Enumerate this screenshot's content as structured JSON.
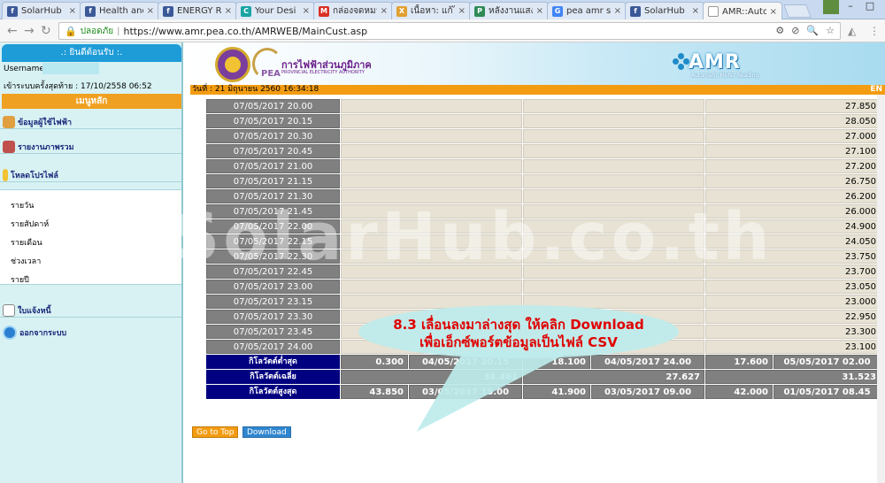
{
  "browser": {
    "tabs": [
      {
        "title": "SolarHub",
        "color": "#3b5998",
        "glyph": "f"
      },
      {
        "title": "Health and",
        "color": "#3b5998",
        "glyph": "f"
      },
      {
        "title": "ENERGY R",
        "color": "#3b5998",
        "glyph": "f"
      },
      {
        "title": "Your Desi",
        "color": "#1aa3a3",
        "glyph": "C"
      },
      {
        "title": "กล่องจดหมา",
        "color": "#d93025",
        "glyph": "M"
      },
      {
        "title": "เนื้อหา: แก้ไข",
        "color": "#e0a030",
        "glyph": "X"
      },
      {
        "title": "หลังงานแสง",
        "color": "#2e8b57",
        "glyph": "P"
      },
      {
        "title": "pea amr s",
        "color": "#4285f4",
        "glyph": "G"
      },
      {
        "title": "SolarHub",
        "color": "#3b5998",
        "glyph": "f"
      },
      {
        "title": "AMR::Auto",
        "color": "#ffffff",
        "glyph": ""
      }
    ],
    "secure_label": "ปลอดภัย",
    "url": "https://www.amr.pea.co.th/AMRWEB/MainCust.asp",
    "window_controls": {
      "minimize": "–",
      "maximize": "□",
      "close": "✕"
    }
  },
  "sidebar": {
    "welcome": ".: ยินดีต้อนรับ :.",
    "username_label": "Username :",
    "last_login": "เข้าระบบครั้งสุดท้าย : 17/10/2558 06:52",
    "main_menu": "เมนูหลัก",
    "items": [
      {
        "label": "ข้อมูลผู้ใช้ไฟฟ้า",
        "icon": "users-icon"
      },
      {
        "label": "รายงานภาพรวม",
        "icon": "report-icon"
      },
      {
        "label": "โหลดโปรไฟล์",
        "icon": "profile-icon"
      }
    ],
    "sub_items": [
      "รายวัน",
      "รายสัปดาห์",
      "รายเดือน",
      "ช่วงเวลา",
      "รายปี"
    ],
    "bill_label": "ใบแจ้งหนี้",
    "logout_label": "ออกจากระบบ"
  },
  "banner": {
    "pea_th": "การไฟฟ้าส่วนภูมิภาค",
    "pea_en": "PROVINCIAL ELECTRICITY AUTHORITY",
    "pea_short": "PEA",
    "amr_logo": "AMR",
    "amr_sub": "Automatic Meter Reading",
    "date_text": "วันที่ : 21 มิถุนายน 2560  16:34:18",
    "lang": "EN"
  },
  "table": {
    "rows": [
      {
        "time": "07/05/2017 20.00",
        "value": "27.850"
      },
      {
        "time": "07/05/2017 20.15",
        "value": "28.050"
      },
      {
        "time": "07/05/2017 20.30",
        "value": "27.000"
      },
      {
        "time": "07/05/2017 20.45",
        "value": "27.100"
      },
      {
        "time": "07/05/2017 21.00",
        "value": "27.200"
      },
      {
        "time": "07/05/2017 21.15",
        "value": "26.750"
      },
      {
        "time": "07/05/2017 21.30",
        "value": "26.200"
      },
      {
        "time": "07/05/2017 21.45",
        "value": "26.000"
      },
      {
        "time": "07/05/2017 22.00",
        "value": "24.900"
      },
      {
        "time": "07/05/2017 22.15",
        "value": "24.050"
      },
      {
        "time": "07/05/2017 22.30",
        "value": "23.750"
      },
      {
        "time": "07/05/2017 22.45",
        "value": "23.700"
      },
      {
        "time": "07/05/2017 23.00",
        "value": "23.050"
      },
      {
        "time": "07/05/2017 23.15",
        "value": "23.000"
      },
      {
        "time": "07/05/2017 23.30",
        "value": "22.950"
      },
      {
        "time": "07/05/2017 23.45",
        "value": "23.300"
      },
      {
        "time": "07/05/2017 24.00",
        "value": "23.100"
      }
    ],
    "summary": [
      {
        "label": "กิโลวัตต์ต่ำสุด",
        "v1": "0.300",
        "t1": "04/05/2017 20.15",
        "v2": "18.100",
        "t2": "04/05/2017 24.00",
        "v3": "17.600",
        "t3": "05/05/2017 02.00"
      },
      {
        "label": "กิโลวัตต์เฉลี่ย",
        "avg1": "34.461",
        "avg2": "27.627",
        "avg3": "31.523"
      },
      {
        "label": "กิโลวัตต์สูงสุด",
        "v1": "43.850",
        "t1": "03/05/2017 15.00",
        "v2": "41.900",
        "t2": "03/05/2017 09.00",
        "v3": "42.000",
        "t3": "01/05/2017 08.45"
      }
    ]
  },
  "buttons": {
    "go_top": "Go to Top",
    "download": "Download"
  },
  "callout": {
    "line1": "8.3 เลื่อนลงมาล่างสุด ให้คลิก Download",
    "line2": "เพื่อเอ็กซ์พอร์ตข้อมูลเป็นไฟล์ CSV"
  },
  "watermark": "SolarHub.co.th",
  "colors": {
    "accent_orange": "#f39c12",
    "header_blue": "#1e9cd8",
    "navy": "#000080",
    "callout_red": "#e00000"
  }
}
